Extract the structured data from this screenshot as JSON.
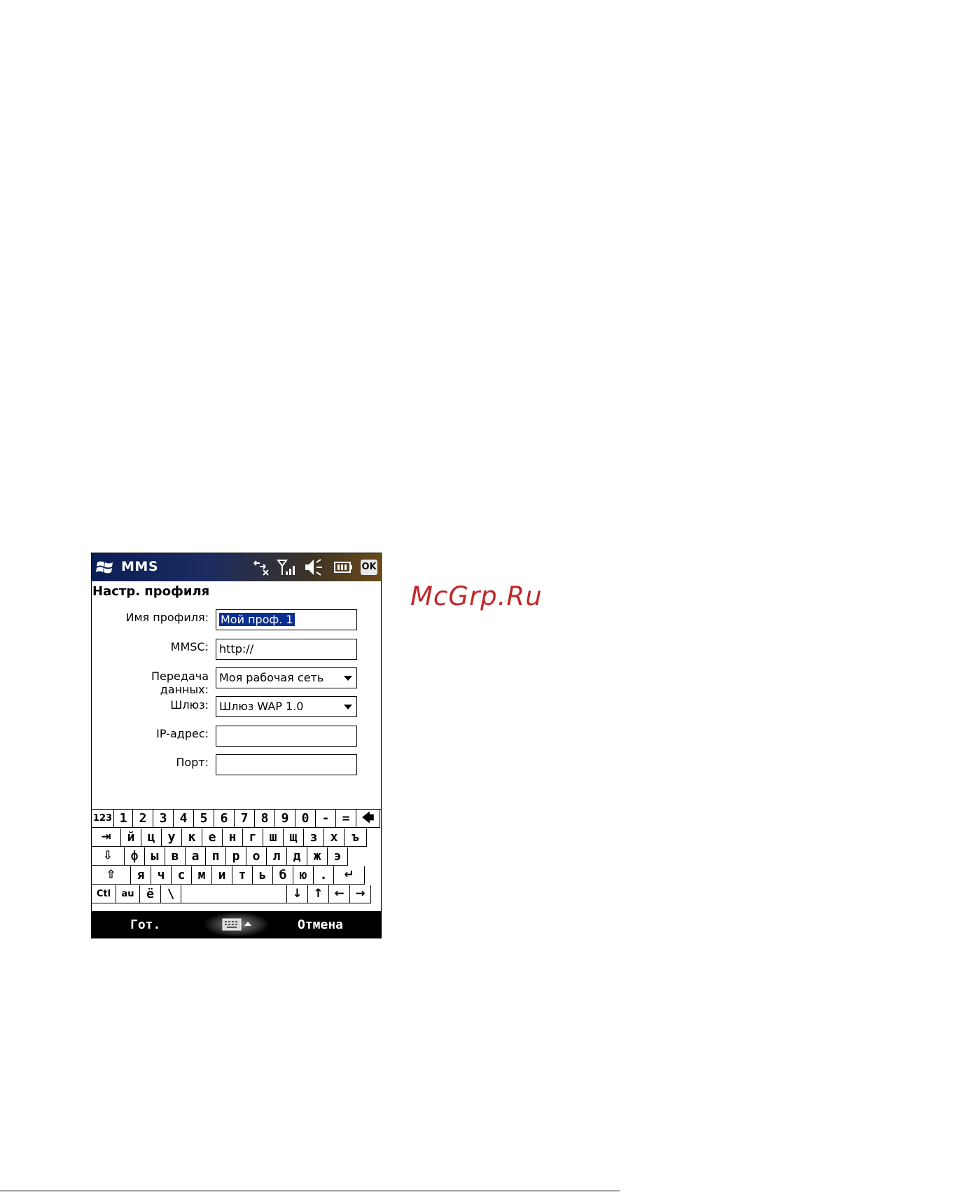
{
  "watermark": "McGrp.Ru",
  "titlebar": {
    "app_title": "MMS",
    "ok_label": "OK"
  },
  "form": {
    "title": "Настр. профиля",
    "fields": [
      {
        "label": "Имя профиля:",
        "value": "Мой проф. 1",
        "selected": true
      },
      {
        "label": "MMSC:",
        "value": "http://"
      },
      {
        "label_line1": "Передача",
        "label_line2": "данных:",
        "value": "Моя рабочая сеть",
        "dropdown": true
      },
      {
        "label": "Шлюз:",
        "value": "Шлюз WAP 1.0",
        "dropdown": true
      },
      {
        "label": "IP-адрес:",
        "value": ""
      },
      {
        "label": "Порт:",
        "value": ""
      }
    ]
  },
  "keyboard": {
    "row1": [
      "123",
      "1",
      "2",
      "3",
      "4",
      "5",
      "6",
      "7",
      "8",
      "9",
      "0",
      "-",
      "=",
      "🡄"
    ],
    "row2": [
      "⇥",
      "й",
      "ц",
      "у",
      "к",
      "е",
      "н",
      "г",
      "ш",
      "щ",
      "з",
      "х",
      "ъ"
    ],
    "row3": [
      "⇩",
      "ф",
      "ы",
      "в",
      "а",
      "п",
      "р",
      "о",
      "л",
      "д",
      "ж",
      "э"
    ],
    "row4": [
      "⇧",
      "я",
      "ч",
      "с",
      "м",
      "и",
      "т",
      "ь",
      "б",
      "ю",
      ".",
      "↵"
    ],
    "row5": [
      "Ctl",
      "au",
      "ё",
      "\\",
      "",
      "↓",
      "↑",
      "←",
      "→"
    ]
  },
  "softkeys": {
    "left": "Гот.",
    "right": "Отмена"
  },
  "icons": {
    "logo": "windows-logo-icon",
    "connectivity": "connectivity-icon",
    "signal": "signal-strength-icon",
    "sound": "speaker-muted-icon",
    "battery": "battery-icon",
    "sip": "keyboard-icon"
  }
}
